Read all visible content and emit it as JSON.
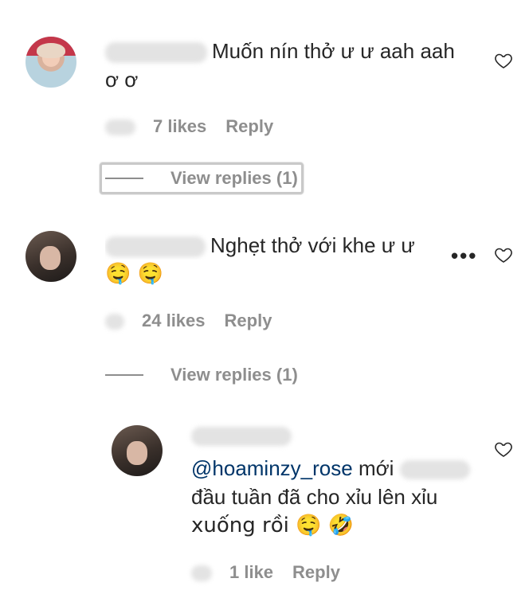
{
  "comments": [
    {
      "text": "Muốn nín thở ư ư aah aah ơ ơ",
      "likes": "7 likes",
      "reply": "Reply",
      "view_replies": "View replies (1)"
    },
    {
      "text_line1": "Nghẹt thở với khe ư ư",
      "emojis": "🤤 🤤",
      "likes": "24 likes",
      "reply": "Reply",
      "view_replies": "View replies (1)"
    }
  ],
  "reply": {
    "mention": "@hoaminzy_rose",
    "text_after_mention": "mới",
    "line2": "đầu tuần đã cho xỉu lên xỉu",
    "line3": "xuống rồi 🤤 🤣",
    "likes": "1 like",
    "reply": "Reply"
  },
  "icons": {
    "heart": "heart-outline-icon",
    "more": "more-options-icon"
  }
}
